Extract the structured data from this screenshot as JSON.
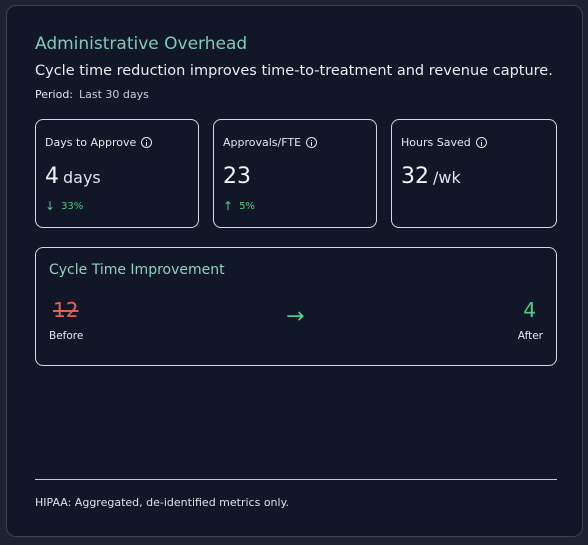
{
  "header": {
    "title": "Administrative Overhead",
    "subtitle": "Cycle time reduction improves time-to-treatment and revenue capture.",
    "period_label": "Period:",
    "period_value": "Last 30 days"
  },
  "metrics": [
    {
      "label": "Days to Approve",
      "value": "4",
      "unit": "days",
      "delta_arrow": "↓",
      "delta": "33%",
      "icon": "info-icon"
    },
    {
      "label": "Approvals/FTE",
      "value": "23",
      "unit": "",
      "delta_arrow": "↑",
      "delta": "5%",
      "icon": "info-icon"
    },
    {
      "label": "Hours Saved",
      "value": "32",
      "unit": "/wk",
      "icon": "info-icon"
    }
  ],
  "cycle": {
    "title": "Cycle Time Improvement",
    "before_value": "12",
    "before_label": "Before",
    "arrow": "→",
    "after_value": "4",
    "after_label": "After"
  },
  "footer": {
    "text": "HIPAA: Aggregated, de-identified metrics only."
  },
  "colors": {
    "accent_title": "#7fcab9",
    "positive": "#56c88a",
    "negative": "#e0605f",
    "card_bg": "#111726"
  }
}
